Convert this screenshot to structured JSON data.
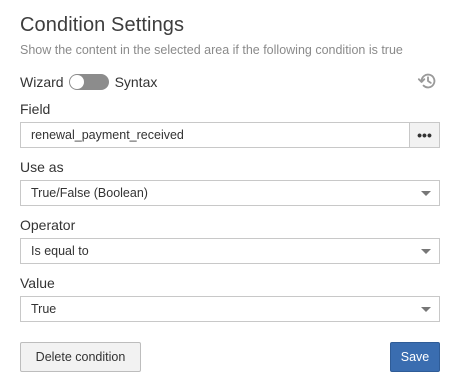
{
  "header": {
    "title": "Condition Settings",
    "subtitle": "Show the content in the selected area if the following condition is true"
  },
  "mode": {
    "wizard_label": "Wizard",
    "syntax_label": "Syntax",
    "toggle_state": "wizard",
    "history_icon": "history-icon"
  },
  "field": {
    "label": "Field",
    "value": "renewal_payment_received",
    "browse_button_icon": "more-icon"
  },
  "use_as": {
    "label": "Use as",
    "value": "True/False (Boolean)"
  },
  "operator": {
    "label": "Operator",
    "value": "Is equal to"
  },
  "value": {
    "label": "Value",
    "value": "True"
  },
  "actions": {
    "delete_label": "Delete condition",
    "save_label": "Save"
  },
  "colors": {
    "primary": "#3a6db0",
    "toggle": "#8c8c8c"
  }
}
